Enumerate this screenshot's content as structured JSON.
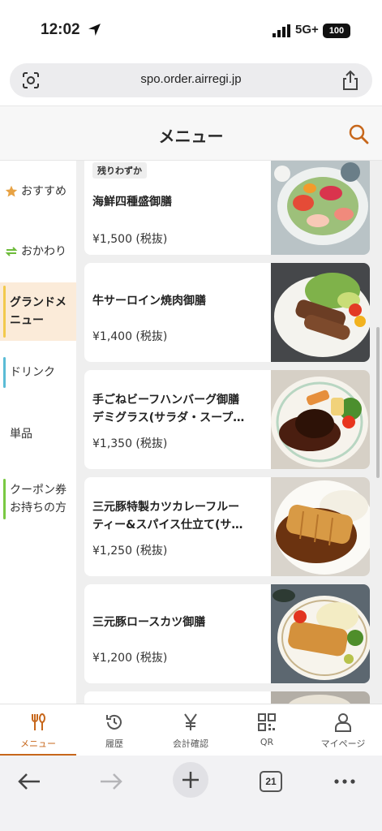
{
  "status_bar": {
    "time": "12:02",
    "network": "5G+",
    "battery": "100"
  },
  "browser": {
    "url": "spo.order.airregi.jp",
    "tab_count": "21"
  },
  "header": {
    "title": "メニュー"
  },
  "sidebar": {
    "items": [
      {
        "label": "おすすめ",
        "icon": "star-icon",
        "bar_color": ""
      },
      {
        "label": "おかわり",
        "icon": "refresh-icon",
        "bar_color": ""
      },
      {
        "label": "グランドメニュー",
        "line1": "グランドメ",
        "line2": "ニュー",
        "active": true,
        "bar_color": "#f2c94c"
      },
      {
        "label": "ドリンク",
        "bar_color": "#5bbcd6"
      },
      {
        "label": "単品",
        "bar_color": ""
      },
      {
        "label": "クーポン券お持ちの方",
        "line1": "クーポン券",
        "line2": "お持ちの方",
        "bar_color": "#7ac943"
      }
    ]
  },
  "menu_items": [
    {
      "badge": "残りわずか",
      "name": "海鮮四種盛御膳",
      "price": "¥1,500 (税抜)",
      "photo": "sashimi-platter"
    },
    {
      "name": "牛サーロイン焼肉御膳",
      "price": "¥1,400 (税抜)",
      "photo": "beef-sirloin-salad"
    },
    {
      "name_line1": "手ごねビーフハンバーグ御膳",
      "name_line2": "デミグラス(サラダ・スープ…",
      "price": "¥1,350 (税抜)",
      "photo": "hamburg-steak"
    },
    {
      "name_line1": "三元豚特製カツカレーフルー",
      "name_line2": "ティー&スパイス仕立て(サ…",
      "price": "¥1,250 (税抜)",
      "photo": "katsu-curry"
    },
    {
      "name": "三元豚ロースカツ御膳",
      "price": "¥1,200 (税抜)",
      "photo": "pork-cutlet"
    }
  ],
  "bottom_nav": [
    {
      "label": "メニュー",
      "icon": "cutlery-icon",
      "active": true
    },
    {
      "label": "履歴",
      "icon": "history-icon"
    },
    {
      "label": "会計確認",
      "icon": "yen-icon"
    },
    {
      "label": "QR",
      "icon": "qr-icon"
    },
    {
      "label": "マイページ",
      "icon": "person-icon"
    }
  ],
  "colors": {
    "accent": "#c7671b",
    "active_bg": "#fbebd9",
    "list_bg": "#efefef"
  }
}
